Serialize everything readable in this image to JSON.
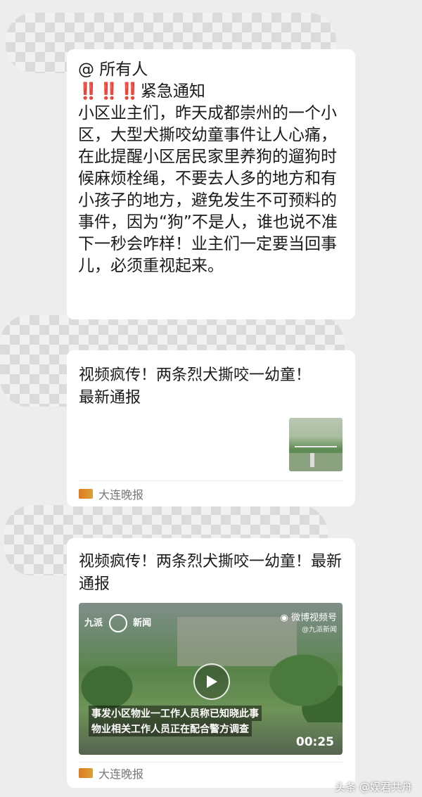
{
  "message1": {
    "mention": "@ 所有人",
    "alert_marks": "‼️‼️‼️",
    "alert_title": "紧急通知",
    "body": "小区业主们，昨天成都崇州的一个小区，大型犬撕咬幼童事件让人心痛，在此提醒小区居民家里养狗的遛狗时候麻烦栓绳，不要去人多的地方和有小孩子的地方，避免发生不可预料的事件，因为“狗”不是人，谁也说不准下一秒会咋样！业主们一定要当回事儿，必须重视起来。"
  },
  "card1": {
    "title": "视频疯传！两条烈犬撕咬一幼童！最新通报",
    "source": "大连晚报"
  },
  "card2": {
    "title": "视频疯传！两条烈犬撕咬一幼童！最新通报",
    "source": "大连晚报",
    "video": {
      "logo_left": "九派",
      "logo_left_sub": "新闻",
      "logo_right": "微博视频号",
      "logo_right_sub": "@九派新闻",
      "caption_line1": "事发小区物业一工作人员称已知晓此事",
      "caption_line2": "物业相关工作人员正在配合警方调查",
      "duration": "00:25"
    }
  },
  "watermark": "头条 @娱君共舟",
  "colors": {
    "background": "#ededed",
    "alert": "#e02020",
    "bubble": "#ffffff"
  }
}
